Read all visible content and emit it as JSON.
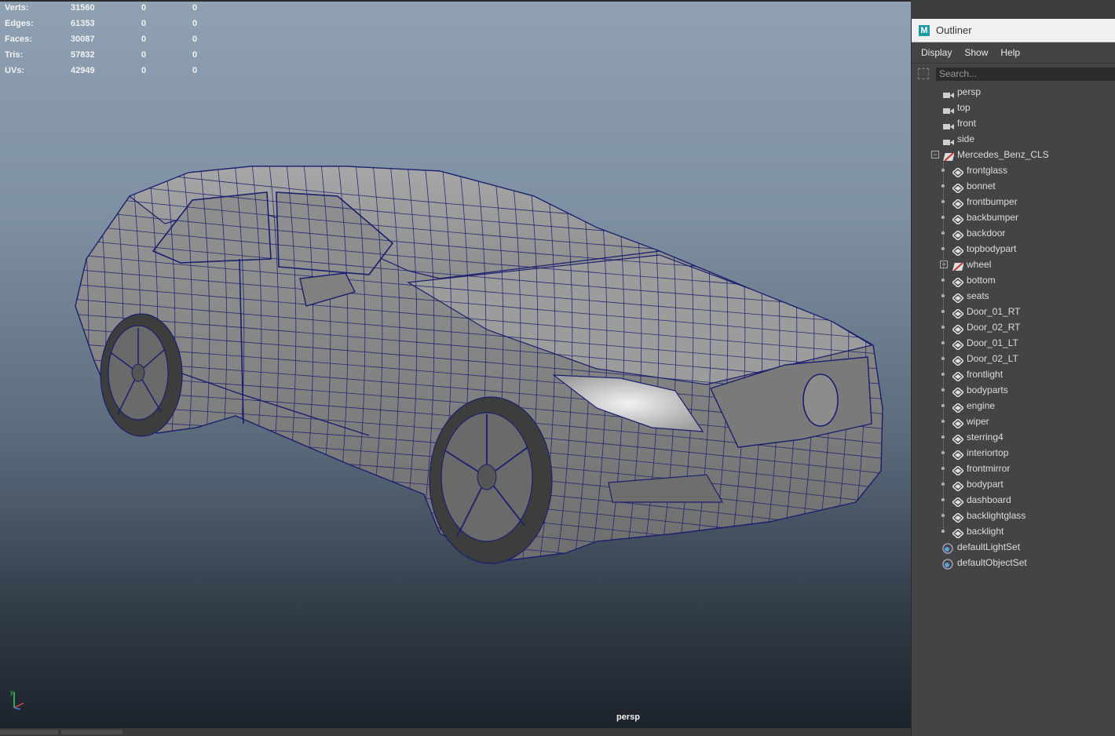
{
  "stats": [
    {
      "label": "Verts:",
      "v1": "31560",
      "v2": "0",
      "v3": "0"
    },
    {
      "label": "Edges:",
      "v1": "61353",
      "v2": "0",
      "v3": "0"
    },
    {
      "label": "Faces:",
      "v1": "30087",
      "v2": "0",
      "v3": "0"
    },
    {
      "label": "Tris:",
      "v1": "57832",
      "v2": "0",
      "v3": "0"
    },
    {
      "label": "UVs:",
      "v1": "42949",
      "v2": "0",
      "v3": "0"
    }
  ],
  "viewport": {
    "camera_label": "persp",
    "axis_label": "y"
  },
  "outliner": {
    "logo": "M",
    "title": "Outliner",
    "menus": [
      "Display",
      "Show",
      "Help"
    ],
    "search_placeholder": "Search...",
    "cameras": [
      "persp",
      "top",
      "front",
      "side"
    ],
    "group": {
      "name": "Mercedes_Benz_CLS",
      "expanded": true
    },
    "children": [
      {
        "name": "frontglass",
        "icon": "mesh-icon"
      },
      {
        "name": "bonnet",
        "icon": "mesh-icon"
      },
      {
        "name": "frontbumper",
        "icon": "mesh-icon"
      },
      {
        "name": "backbumper",
        "icon": "mesh-icon"
      },
      {
        "name": "backdoor",
        "icon": "mesh-icon"
      },
      {
        "name": "topbodypart",
        "icon": "mesh-icon"
      },
      {
        "name": "wheel",
        "icon": "group-icon",
        "collapsed": true
      },
      {
        "name": "bottom",
        "icon": "mesh-icon"
      },
      {
        "name": "seats",
        "icon": "mesh-icon"
      },
      {
        "name": "Door_01_RT",
        "icon": "mesh-icon"
      },
      {
        "name": "Door_02_RT",
        "icon": "mesh-icon"
      },
      {
        "name": "Door_01_LT",
        "icon": "mesh-icon"
      },
      {
        "name": "Door_02_LT",
        "icon": "mesh-icon"
      },
      {
        "name": "frontlight",
        "icon": "mesh-icon"
      },
      {
        "name": "bodyparts",
        "icon": "mesh-icon"
      },
      {
        "name": "engine",
        "icon": "mesh-icon"
      },
      {
        "name": "wiper",
        "icon": "mesh-icon"
      },
      {
        "name": "sterring4",
        "icon": "mesh-icon"
      },
      {
        "name": "interiortop",
        "icon": "mesh-icon"
      },
      {
        "name": "frontmirror",
        "icon": "mesh-icon"
      },
      {
        "name": "bodypart",
        "icon": "mesh-icon"
      },
      {
        "name": "dashboard",
        "icon": "mesh-icon"
      },
      {
        "name": "backlightglass",
        "icon": "mesh-icon"
      },
      {
        "name": "backlight",
        "icon": "mesh-icon"
      }
    ],
    "sets": [
      "defaultLightSet",
      "defaultObjectSet"
    ]
  },
  "colors": {
    "wire": "#1a1f6e",
    "body": "#8a8a8a",
    "panel": "#444444",
    "outliner_title_bg": "#f0f0f0"
  }
}
